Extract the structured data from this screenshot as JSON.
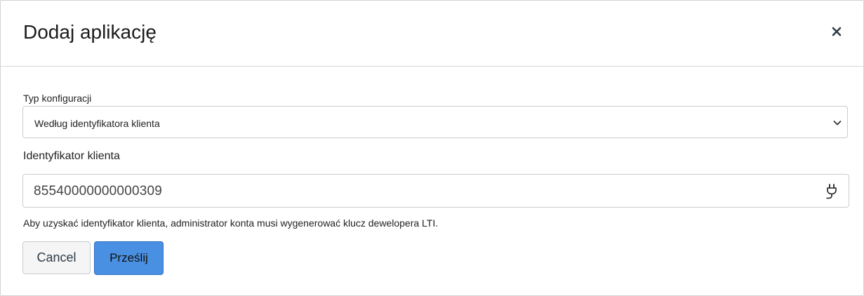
{
  "dialog": {
    "title": "Dodaj aplikację",
    "close_icon": "close-icon"
  },
  "form": {
    "config_type": {
      "label": "Typ konfiguracji",
      "selected": "Według identyfikatora klienta",
      "chevron_icon": "chevron-down-icon"
    },
    "client_id": {
      "label": "Identyfikator klienta",
      "value": "85540000000000309",
      "plug_icon": "plug-icon"
    },
    "hint": "Aby uzyskać identyfikator klienta, administrator konta musi wygenerować klucz dewelopera LTI."
  },
  "actions": {
    "cancel_label": "Cancel",
    "submit_label": "Prześlij"
  },
  "colors": {
    "primary": "#4a90e2",
    "border": "#c7cdd1"
  }
}
